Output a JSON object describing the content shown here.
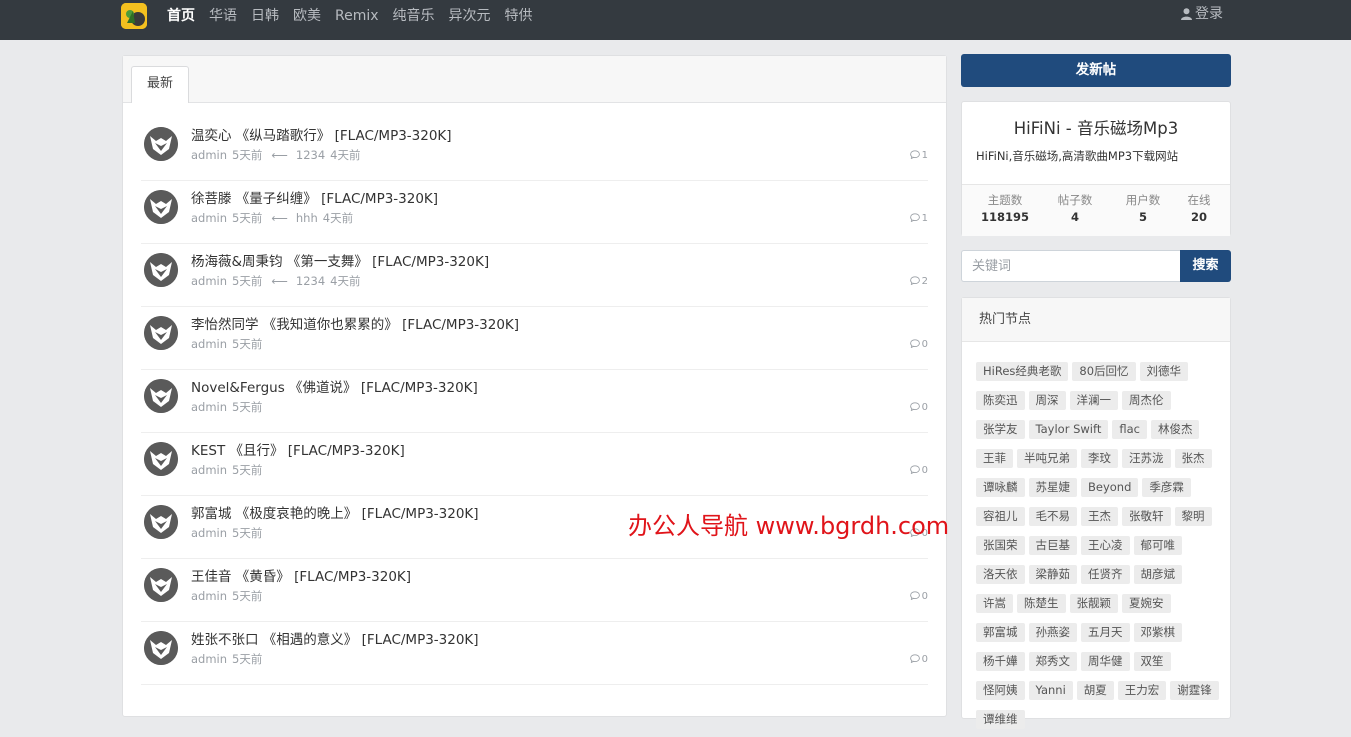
{
  "nav": {
    "links": [
      "首页",
      "华语",
      "日韩",
      "欧美",
      "Remix",
      "纯音乐",
      "异次元",
      "特供"
    ],
    "active_index": 0,
    "login_label": "登录"
  },
  "main": {
    "tab_label": "最新",
    "threads": [
      {
        "title": "温奕心 《纵马踏歌行》 [FLAC/MP3-320K]",
        "author": "admin",
        "time": "5天前",
        "last_user": "1234",
        "last_time": "4天前",
        "replies": "1"
      },
      {
        "title": "徐菩滕 《量子纠缠》 [FLAC/MP3-320K]",
        "author": "admin",
        "time": "5天前",
        "last_user": "hhh",
        "last_time": "4天前",
        "replies": "1"
      },
      {
        "title": "杨海薇&周秉钧 《第一支舞》 [FLAC/MP3-320K]",
        "author": "admin",
        "time": "5天前",
        "last_user": "1234",
        "last_time": "4天前",
        "replies": "2"
      },
      {
        "title": "李怡然同学 《我知道你也累累的》 [FLAC/MP3-320K]",
        "author": "admin",
        "time": "5天前",
        "last_user": "",
        "last_time": "",
        "replies": "0"
      },
      {
        "title": "Novel&Fergus 《佛道说》 [FLAC/MP3-320K]",
        "author": "admin",
        "time": "5天前",
        "last_user": "",
        "last_time": "",
        "replies": "0"
      },
      {
        "title": "KEST 《且行》 [FLAC/MP3-320K]",
        "author": "admin",
        "time": "5天前",
        "last_user": "",
        "last_time": "",
        "replies": "0"
      },
      {
        "title": "郭富城 《极度哀艳的晚上》 [FLAC/MP3-320K]",
        "author": "admin",
        "time": "5天前",
        "last_user": "",
        "last_time": "",
        "replies": "0"
      },
      {
        "title": "王佳音 《黄昏》 [FLAC/MP3-320K]",
        "author": "admin",
        "time": "5天前",
        "last_user": "",
        "last_time": "",
        "replies": "0"
      },
      {
        "title": "姓张不张口 《相遇的意义》 [FLAC/MP3-320K]",
        "author": "admin",
        "time": "5天前",
        "last_user": "",
        "last_time": "",
        "replies": "0"
      }
    ]
  },
  "sidebar": {
    "new_post_label": "发新帖",
    "site_title": "HiFiNi - 音乐磁场Mp3",
    "site_desc": "HiFiNi,音乐磁场,高清歌曲MP3下载网站",
    "stats": [
      {
        "label": "主题数",
        "value": "118195"
      },
      {
        "label": "帖子数",
        "value": "4"
      },
      {
        "label": "用户数",
        "value": "5"
      },
      {
        "label": "在线",
        "value": "20"
      }
    ],
    "search_placeholder": "关键词",
    "search_label": "搜索",
    "hot_title": "热门节点",
    "tags": [
      "HiRes经典老歌",
      "80后回忆",
      "刘德华",
      "陈奕迅",
      "周深",
      "洋澜一",
      "周杰伦",
      "张学友",
      "Taylor Swift",
      "flac",
      "林俊杰",
      "王菲",
      "半吨兄弟",
      "李玟",
      "汪苏泷",
      "张杰",
      "谭咏麟",
      "苏星婕",
      "Beyond",
      "季彦霖",
      "容祖儿",
      "毛不易",
      "王杰",
      "张敬轩",
      "黎明",
      "张国荣",
      "古巨基",
      "王心凌",
      "郁可唯",
      "洛天依",
      "梁静茹",
      "任贤齐",
      "胡彦斌",
      "许嵩",
      "陈楚生",
      "张靓颖",
      "夏婉安",
      "郭富城",
      "孙燕姿",
      "五月天",
      "邓紫棋",
      "杨千嬅",
      "郑秀文",
      "周华健",
      "双笙",
      "怪阿姨",
      "Yanni",
      "胡夏",
      "王力宏",
      "谢霆锋",
      "谭维维"
    ]
  },
  "watermark": "办公人导航 www.bgrdh.com"
}
